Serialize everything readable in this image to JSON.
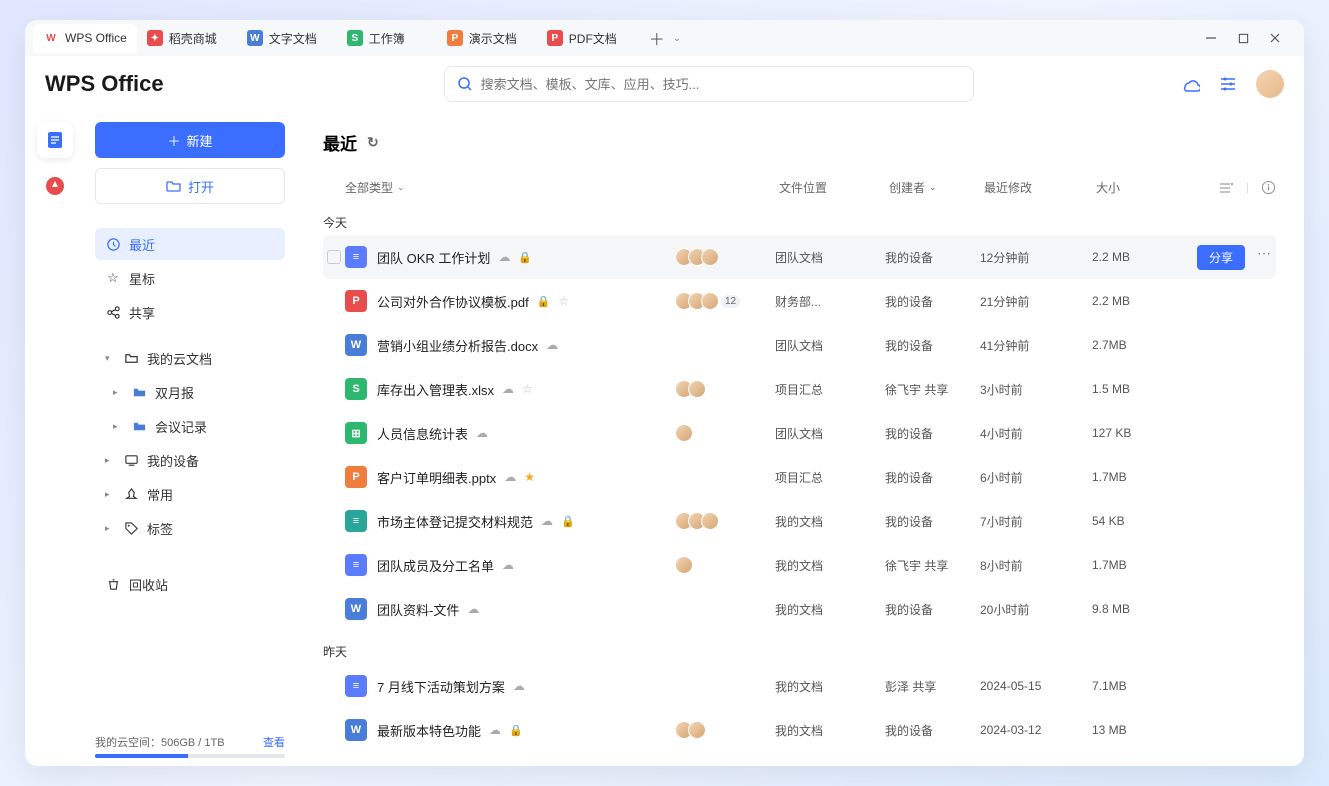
{
  "tabs": [
    {
      "icon_bg": "#fff",
      "icon_fg": "#e84c4c",
      "icon_txt": "W",
      "label": "WPS Office"
    },
    {
      "icon_bg": "#e84c4c",
      "icon_fg": "#fff",
      "icon_txt": "✦",
      "label": "稻壳商城"
    },
    {
      "icon_bg": "#4a7dd8",
      "icon_fg": "#fff",
      "icon_txt": "W",
      "label": "文字文档"
    },
    {
      "icon_bg": "#2eb86f",
      "icon_fg": "#fff",
      "icon_txt": "S",
      "label": "工作簿"
    },
    {
      "icon_bg": "#f07c3e",
      "icon_fg": "#fff",
      "icon_txt": "P",
      "label": "演示文档"
    },
    {
      "icon_bg": "#e84c4c",
      "icon_fg": "#fff",
      "icon_txt": "P",
      "label": "PDF文档"
    }
  ],
  "logo": "WPS Office",
  "search_placeholder": "搜索文档、模板、文库、应用、技巧...",
  "sidebar": {
    "new_label": "新建",
    "open_label": "打开",
    "nav": {
      "recent": "最近",
      "star": "星标",
      "share": "共享",
      "cloud": "我的云文档",
      "sub1": "双月报",
      "sub2": "会议记录",
      "device": "我的设备",
      "freq": "常用",
      "tags": "标签",
      "trash": "回收站"
    },
    "storage_label": "我的云空间：506GB / 1TB",
    "storage_link": "查看"
  },
  "main": {
    "title": "最近",
    "filter_label": "全部类型",
    "cols": {
      "loc": "文件位置",
      "creator": "创建者",
      "mod": "最近修改",
      "size": "大小"
    },
    "today": "今天",
    "yesterday": "昨天",
    "share_btn": "分享"
  },
  "files_today": [
    {
      "icon": "ic-doc",
      "glyph": "≡",
      "name": "团队 OKR 工作计划",
      "cloud": true,
      "lock": true,
      "star": "",
      "avatars": 3,
      "loc": "团队文档",
      "creator": "我的设备",
      "mod": "12分钟前",
      "size": "2.2 MB",
      "hover": true
    },
    {
      "icon": "ic-pdf",
      "glyph": "P",
      "name": "公司对外合作协议模板.pdf",
      "cloud": false,
      "lock": true,
      "star": "off",
      "avatars": 3,
      "avatars_more": "12",
      "loc": "财务部...",
      "creator": "我的设备",
      "mod": "21分钟前",
      "size": "2.2 MB"
    },
    {
      "icon": "ic-word",
      "glyph": "W",
      "name": "营销小组业绩分析报告.docx",
      "cloud": true,
      "lock": false,
      "star": "",
      "avatars": 0,
      "loc": "团队文档",
      "creator": "我的设备",
      "mod": "41分钟前",
      "size": "2.7MB"
    },
    {
      "icon": "ic-sheet",
      "glyph": "S",
      "name": "库存出入管理表.xlsx",
      "cloud": true,
      "lock": false,
      "star": "off",
      "avatars": 2,
      "loc": "项目汇总",
      "creator": "徐飞宇 共享",
      "mod": "3小时前",
      "size": "1.5 MB"
    },
    {
      "icon": "ic-table",
      "glyph": "⊞",
      "name": "人员信息统计表",
      "cloud": true,
      "lock": false,
      "star": "",
      "avatars": 1,
      "loc": "团队文档",
      "creator": "我的设备",
      "mod": "4小时前",
      "size": "127 KB"
    },
    {
      "icon": "ic-ppt",
      "glyph": "P",
      "name": "客户订单明细表.pptx",
      "cloud": true,
      "lock": false,
      "star": "on",
      "avatars": 0,
      "loc": "项目汇总",
      "creator": "我的设备",
      "mod": "6小时前",
      "size": "1.7MB"
    },
    {
      "icon": "ic-teal",
      "glyph": "≡",
      "name": "市场主体登记提交材料规范",
      "cloud": true,
      "lock": true,
      "star": "",
      "avatars": 3,
      "loc": "我的文档",
      "creator": "我的设备",
      "mod": "7小时前",
      "size": "54 KB"
    },
    {
      "icon": "ic-doc",
      "glyph": "≡",
      "name": "团队成员及分工名单",
      "cloud": true,
      "lock": false,
      "star": "",
      "avatars": 1,
      "loc": "我的文档",
      "creator": "徐飞宇 共享",
      "mod": "8小时前",
      "size": "1.7MB"
    },
    {
      "icon": "ic-word",
      "glyph": "W",
      "name": "团队资料-文件",
      "cloud": true,
      "lock": false,
      "star": "",
      "avatars": 0,
      "loc": "我的文档",
      "creator": "我的设备",
      "mod": "20小时前",
      "size": "9.8 MB"
    }
  ],
  "files_yesterday": [
    {
      "icon": "ic-doc",
      "glyph": "≡",
      "name": "7 月线下活动策划方案",
      "cloud": true,
      "lock": false,
      "star": "",
      "avatars": 0,
      "loc": "我的文档",
      "creator": "彭泽 共享",
      "mod": "2024-05-15",
      "size": "7.1MB"
    },
    {
      "icon": "ic-word",
      "glyph": "W",
      "name": "最新版本特色功能",
      "cloud": true,
      "lock": true,
      "star": "",
      "avatars": 2,
      "loc": "我的文档",
      "creator": "我的设备",
      "mod": "2024-03-12",
      "size": "13 MB"
    }
  ]
}
